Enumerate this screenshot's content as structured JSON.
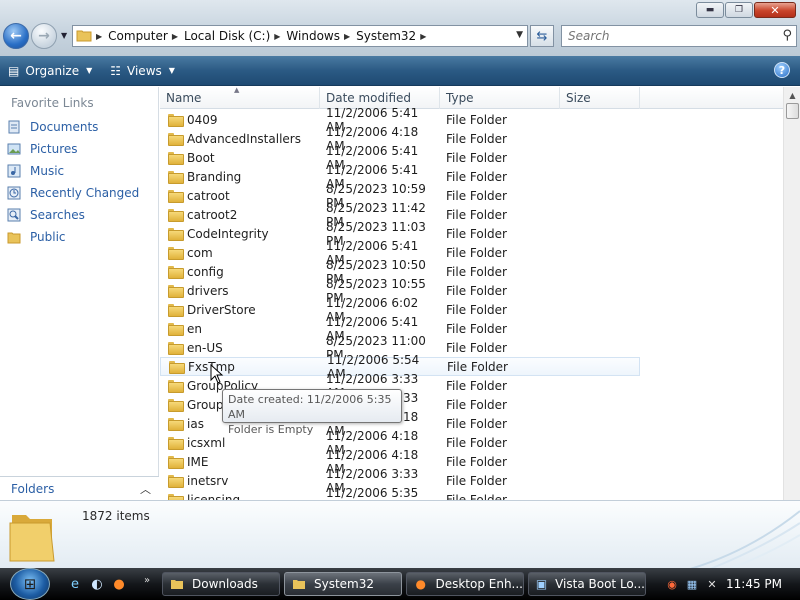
{
  "window_controls": {
    "minimize": "▬",
    "maximize": "❐",
    "close": "✕"
  },
  "address": {
    "crumbs": [
      "Computer",
      "Local Disk (C:)",
      "Windows",
      "System32"
    ]
  },
  "search": {
    "placeholder": "Search"
  },
  "toolbar": {
    "organize_label": "Organize",
    "views_label": "Views",
    "help_label": "?"
  },
  "nav": {
    "favorites_heading": "Favorite Links",
    "items": [
      {
        "label": "Documents",
        "icon": "documents-icon"
      },
      {
        "label": "Pictures",
        "icon": "pictures-icon"
      },
      {
        "label": "Music",
        "icon": "music-icon"
      },
      {
        "label": "Recently Changed",
        "icon": "recently-changed-icon"
      },
      {
        "label": "Searches",
        "icon": "searches-icon"
      },
      {
        "label": "Public",
        "icon": "public-icon"
      }
    ],
    "folders_label": "Folders"
  },
  "columns": {
    "name": "Name",
    "date": "Date modified",
    "type": "Type",
    "size": "Size"
  },
  "files": [
    {
      "name": "0409",
      "date": "11/2/2006 5:41 AM",
      "type": "File Folder"
    },
    {
      "name": "AdvancedInstallers",
      "date": "11/2/2006 4:18 AM",
      "type": "File Folder"
    },
    {
      "name": "Boot",
      "date": "11/2/2006 5:41 AM",
      "type": "File Folder"
    },
    {
      "name": "Branding",
      "date": "11/2/2006 5:41 AM",
      "type": "File Folder"
    },
    {
      "name": "catroot",
      "date": "8/25/2023 10:59 PM",
      "type": "File Folder"
    },
    {
      "name": "catroot2",
      "date": "8/25/2023 11:42 PM",
      "type": "File Folder"
    },
    {
      "name": "CodeIntegrity",
      "date": "8/25/2023 11:03 PM",
      "type": "File Folder"
    },
    {
      "name": "com",
      "date": "11/2/2006 5:41 AM",
      "type": "File Folder"
    },
    {
      "name": "config",
      "date": "8/25/2023 10:50 PM",
      "type": "File Folder"
    },
    {
      "name": "drivers",
      "date": "8/25/2023 10:55 PM",
      "type": "File Folder"
    },
    {
      "name": "DriverStore",
      "date": "11/2/2006 6:02 AM",
      "type": "File Folder"
    },
    {
      "name": "en",
      "date": "11/2/2006 5:41 AM",
      "type": "File Folder"
    },
    {
      "name": "en-US",
      "date": "8/25/2023 11:00 PM",
      "type": "File Folder"
    },
    {
      "name": "FxsTmp",
      "date": "11/2/2006 5:54 AM",
      "type": "File Folder"
    },
    {
      "name": "GroupPolicy",
      "date": "11/2/2006 3:33 AM",
      "type": "File Folder"
    },
    {
      "name": "GroupPolicyUsers",
      "date": "11/2/2006 3:33 AM",
      "type": "File Folder"
    },
    {
      "name": "ias",
      "date": "11/2/2006 4:18 AM",
      "type": "File Folder"
    },
    {
      "name": "icsxml",
      "date": "11/2/2006 4:18 AM",
      "type": "File Folder"
    },
    {
      "name": "IME",
      "date": "11/2/2006 4:18 AM",
      "type": "File Folder"
    },
    {
      "name": "inetsrv",
      "date": "11/2/2006 3:33 AM",
      "type": "File Folder"
    },
    {
      "name": "licensing",
      "date": "11/2/2006 5:35 AM",
      "type": "File Folder"
    }
  ],
  "hovered_index": 13,
  "tooltip": {
    "line1": "Date created: 11/2/2006 5:35 AM",
    "line2": "Folder is Empty"
  },
  "details": {
    "item_count": "1872 items"
  },
  "taskbar": {
    "tasks": [
      {
        "label": "Downloads",
        "icon": "folder-icon",
        "active": false
      },
      {
        "label": "System32",
        "icon": "folder-icon",
        "active": true
      },
      {
        "label": "Desktop Enh...",
        "icon": "firefox-icon",
        "active": false
      },
      {
        "label": "Vista Boot Lo...",
        "icon": "app-window-icon",
        "active": false
      }
    ],
    "quicklaunch_more": "»",
    "clock": "11:45 PM"
  },
  "colors": {
    "toolbar": "#2b5a84",
    "link": "#2b5fa5",
    "folder": "#e9c35a"
  }
}
